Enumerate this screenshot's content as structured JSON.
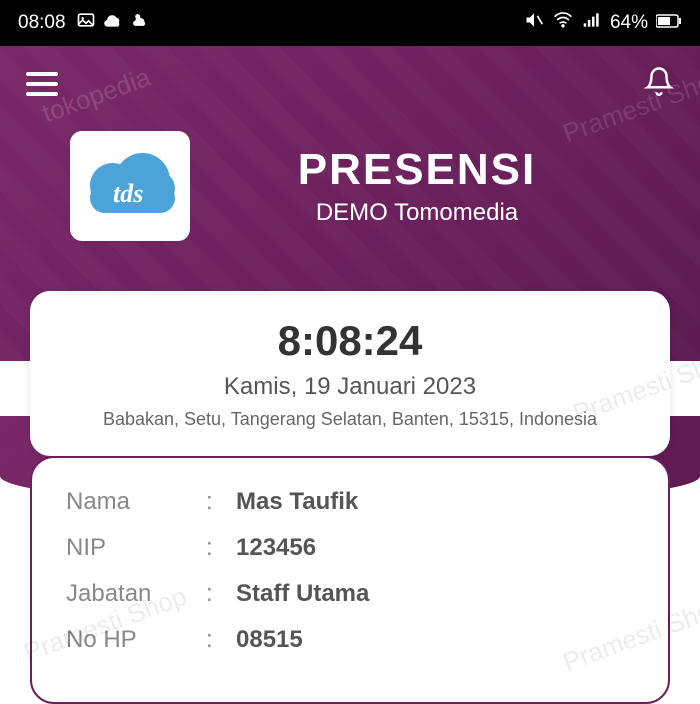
{
  "status": {
    "time": "08:08",
    "battery": "64%"
  },
  "brand": {
    "title": "PRESENSI",
    "subtitle": "DEMO Tomomedia",
    "logo_text": "tds"
  },
  "clock": {
    "time": "8:08:24",
    "date": "Kamis, 19 Januari 2023",
    "location": "Babakan, Setu, Tangerang Selatan, Banten, 15315, Indonesia"
  },
  "info": {
    "rows": [
      {
        "label": "Nama",
        "value": "Mas Taufik"
      },
      {
        "label": "NIP",
        "value": "123456"
      },
      {
        "label": "Jabatan",
        "value": "Staff Utama"
      },
      {
        "label": "No HP",
        "value": "08515"
      }
    ]
  },
  "watermark": "Pramesti Shop",
  "watermark2": "tokopedia"
}
